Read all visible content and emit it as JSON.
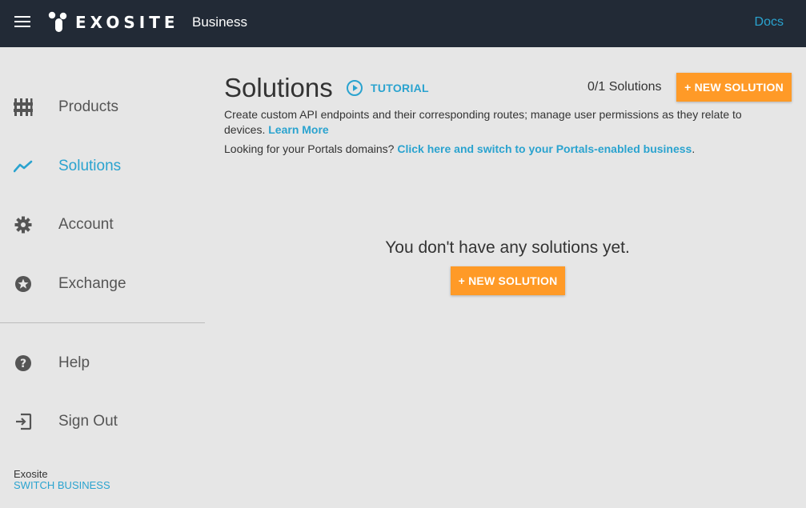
{
  "header": {
    "logo_text": "EXOSITE",
    "business": "Business",
    "docs": "Docs"
  },
  "sidebar": {
    "items": [
      {
        "label": "Products",
        "icon": "products-icon"
      },
      {
        "label": "Solutions",
        "icon": "solutions-icon",
        "active": true
      },
      {
        "label": "Account",
        "icon": "gear-icon"
      },
      {
        "label": "Exchange",
        "icon": "star-icon"
      },
      {
        "label": "Help",
        "icon": "help-icon"
      },
      {
        "label": "Sign Out",
        "icon": "sign-out-icon"
      }
    ],
    "org_name": "Exosite",
    "switch_business": "SWITCH BUSINESS"
  },
  "main": {
    "title": "Solutions",
    "tutorial": "TUTORIAL",
    "solutions_count": "0/1 Solutions",
    "new_solution": "+ NEW SOLUTION",
    "description": "Create custom API endpoints and their corresponding routes; manage user permissions as they relate to devices.",
    "learn_more": "Learn More",
    "portals_prefix": "Looking for your Portals domains?",
    "portals_link": "Click here and switch to your Portals-enabled business",
    "portals_suffix": ".",
    "empty_message": "You don't have any solutions yet.",
    "empty_button": "+ NEW SOLUTION"
  },
  "colors": {
    "topbar": "#222a36",
    "accent": "#2aa3cf",
    "button": "#ff9a27",
    "background": "#e6e6e6"
  }
}
